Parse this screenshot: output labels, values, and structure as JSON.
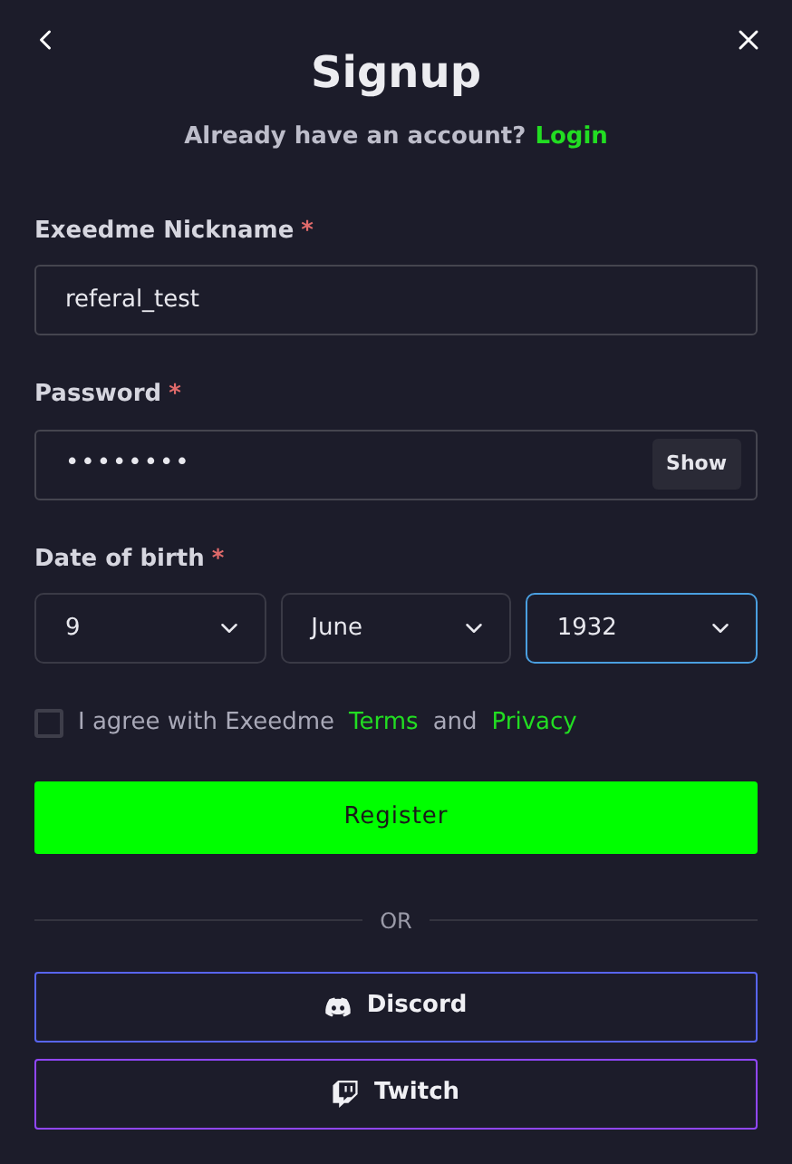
{
  "title": "Signup",
  "subtitle": {
    "text": "Already have an account?",
    "link": "Login"
  },
  "fields": [
    {
      "kind": "text",
      "label": "Exeedme Nickname",
      "required_mark": "*",
      "value": "referal_test"
    },
    {
      "kind": "password",
      "label": "Password",
      "required_mark": "*",
      "value": "••••••••",
      "button": "Show"
    }
  ],
  "date_of_birth": {
    "label": "Date of birth",
    "required_mark": "*",
    "selects": [
      {
        "value": "9",
        "focused": false
      },
      {
        "value": "June",
        "focused": false
      },
      {
        "value": "1932",
        "focused": true
      }
    ]
  },
  "agreement": {
    "checked": false,
    "text": "I agree with Exeedme",
    "terms": "Terms",
    "middle": "and",
    "privacy": "Privacy"
  },
  "register_button": "Register",
  "divider": "OR",
  "social_buttons": [
    {
      "kind": "discord",
      "label": "Discord",
      "color": "#5865f2"
    },
    {
      "kind": "twitch",
      "label": "Twitch",
      "color": "#9146ff"
    }
  ]
}
